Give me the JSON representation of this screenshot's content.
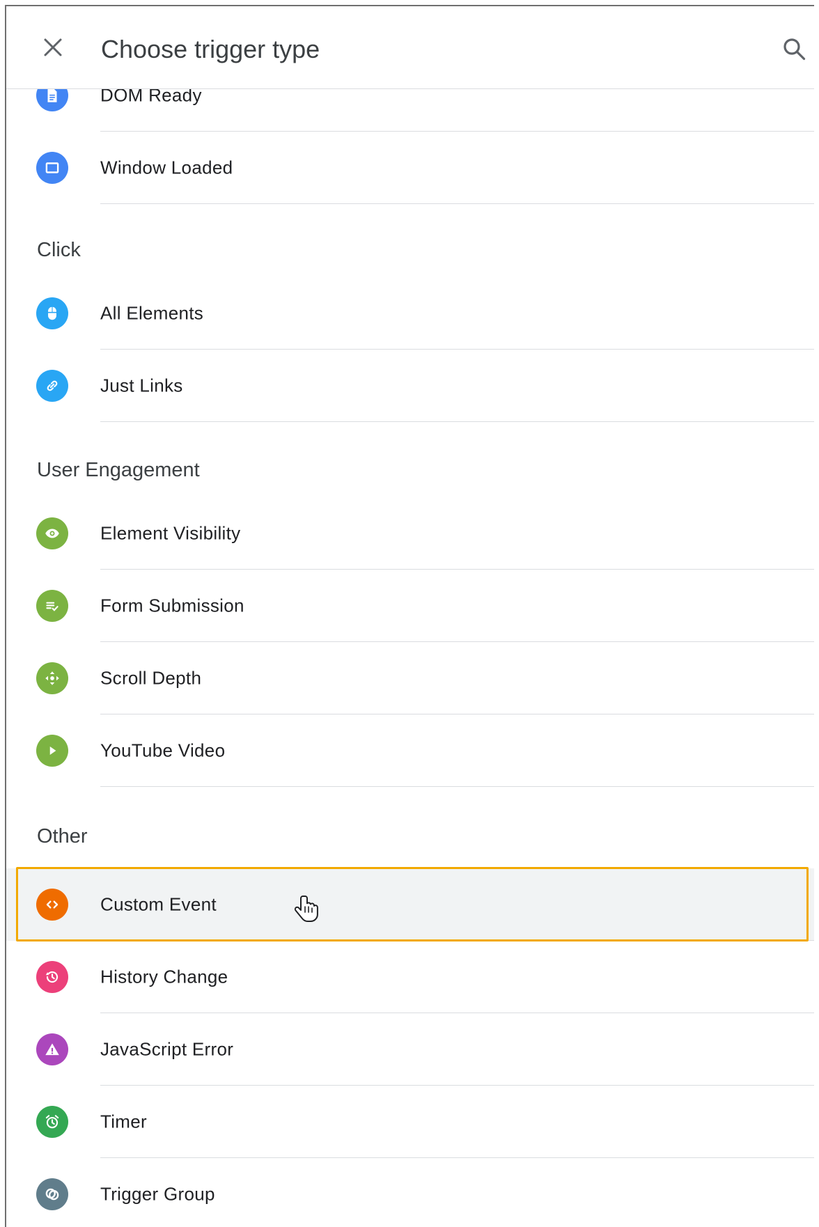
{
  "header": {
    "title": "Choose trigger type",
    "close_icon": "close-icon",
    "search_icon": "search-icon"
  },
  "sections": {
    "click": "Click",
    "user_engagement": "User Engagement",
    "other": "Other"
  },
  "items": {
    "dom_ready": {
      "label": "DOM Ready",
      "color": "#4285f4",
      "icon": "document-icon"
    },
    "window_loaded": {
      "label": "Window Loaded",
      "color": "#4285f4",
      "icon": "window-icon"
    },
    "all_elements": {
      "label": "All Elements",
      "color": "#29a6f4",
      "icon": "mouse-icon"
    },
    "just_links": {
      "label": "Just Links",
      "color": "#29a6f4",
      "icon": "link-icon"
    },
    "element_visibility": {
      "label": "Element Visibility",
      "color": "#7cb342",
      "icon": "eye-icon"
    },
    "form_submission": {
      "label": "Form Submission",
      "color": "#7cb342",
      "icon": "form-check-icon"
    },
    "scroll_depth": {
      "label": "Scroll Depth",
      "color": "#7cb342",
      "icon": "move-arrows-icon"
    },
    "youtube_video": {
      "label": "YouTube Video",
      "color": "#7cb342",
      "icon": "play-icon"
    },
    "custom_event": {
      "label": "Custom Event",
      "color": "#ef6c00",
      "icon": "code-brackets-icon"
    },
    "history_change": {
      "label": "History Change",
      "color": "#ec407a",
      "icon": "history-icon"
    },
    "javascript_error": {
      "label": "JavaScript Error",
      "color": "#ab47bc",
      "icon": "warning-icon"
    },
    "timer": {
      "label": "Timer",
      "color": "#34a853",
      "icon": "alarm-clock-icon"
    },
    "trigger_group": {
      "label": "Trigger Group",
      "color": "#607d8b",
      "icon": "group-circles-icon"
    }
  },
  "colors": {
    "highlight_outline": "#f2a900",
    "hover_background": "#f1f3f4",
    "divider": "#dadce0"
  }
}
